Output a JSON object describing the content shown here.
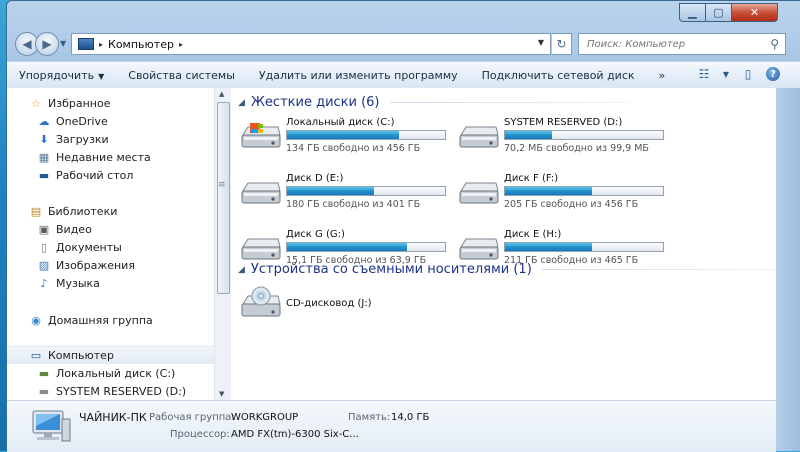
{
  "window": {
    "caption_buttons": {
      "minimize": "▁",
      "maximize": "▢",
      "close": "✕"
    }
  },
  "address_bar": {
    "path_separator": "▸",
    "location": "Компьютер",
    "search_placeholder": "Поиск: Компьютер"
  },
  "toolbar": {
    "items": [
      {
        "label": "Упорядочить",
        "has_dropdown": true
      },
      {
        "label": "Свойства системы"
      },
      {
        "label": "Удалить или изменить программу"
      },
      {
        "label": "Подключить сетевой диск"
      },
      {
        "label": "»"
      }
    ],
    "icons": [
      "view-options-icon",
      "preview-pane-icon",
      "help-icon"
    ]
  },
  "navigation": {
    "items": [
      {
        "label": "Избранное",
        "icon": "star-icon",
        "indent": 0
      },
      {
        "label": "OneDrive",
        "icon": "onedrive-icon",
        "indent": 1
      },
      {
        "label": "Загрузки",
        "icon": "downloads-icon",
        "indent": 1
      },
      {
        "label": "Недавние места",
        "icon": "recent-places-icon",
        "indent": 1
      },
      {
        "label": "Рабочий стол",
        "icon": "desktop-icon",
        "indent": 1
      },
      {
        "label": "Библиотеки",
        "icon": "libraries-icon",
        "indent": 0
      },
      {
        "label": "Видео",
        "icon": "video-icon",
        "indent": 1
      },
      {
        "label": "Документы",
        "icon": "documents-icon",
        "indent": 1
      },
      {
        "label": "Изображения",
        "icon": "pictures-icon",
        "indent": 1
      },
      {
        "label": "Музыка",
        "icon": "music-icon",
        "indent": 1
      },
      {
        "label": "Домашняя группа",
        "icon": "homegroup-icon",
        "indent": 0
      },
      {
        "label": "Компьютер",
        "icon": "computer-icon",
        "indent": 0,
        "selected": true
      },
      {
        "label": "Локальный диск (C:)",
        "icon": "system-drive-icon",
        "indent": 1
      },
      {
        "label": "SYSTEM RESERVED (D:)",
        "icon": "drive-icon",
        "indent": 1
      }
    ]
  },
  "groups": {
    "hard_drives": {
      "title": "Жесткие диски (6)"
    },
    "removable": {
      "title": "Устройства со съемными носителями (1)"
    }
  },
  "drives": [
    {
      "name": "Локальный диск (C:)",
      "free_text": "134 ГБ свободно из 456 ГБ",
      "used_fraction": 0.71,
      "system": true
    },
    {
      "name": "SYSTEM RESERVED (D:)",
      "free_text": "70,2 МБ свободно из 99,9 МБ",
      "used_fraction": 0.3,
      "system": false
    },
    {
      "name": "Диск D (E:)",
      "free_text": "180 ГБ свободно из 401 ГБ",
      "used_fraction": 0.55,
      "system": false
    },
    {
      "name": "Диск F (F:)",
      "free_text": "205 ГБ свободно из 456 ГБ",
      "used_fraction": 0.55,
      "system": false
    },
    {
      "name": "Диск G (G:)",
      "free_text": "15,1 ГБ свободно из 63,9 ГБ",
      "used_fraction": 0.76,
      "system": false
    },
    {
      "name": "Диск E (H:)",
      "free_text": "211 ГБ свободно из 465 ГБ",
      "used_fraction": 0.55,
      "system": false
    }
  ],
  "removable_devices": [
    {
      "name": "CD-дисковод (J:)"
    }
  ],
  "details": {
    "computer_name": "ЧАЙНИК-ПК",
    "workgroup_label": "Рабочая группа:",
    "workgroup_value": "WORKGROUP",
    "memory_label": "Память:",
    "memory_value": "14,0 ГБ",
    "processor_label": "Процессор:",
    "processor_value": "AMD FX(tm)-6300 Six-C..."
  },
  "colors": {
    "group_title": "#1e3287",
    "bar_fill": "#1f8fc9",
    "desktop": "#1c84c0"
  }
}
